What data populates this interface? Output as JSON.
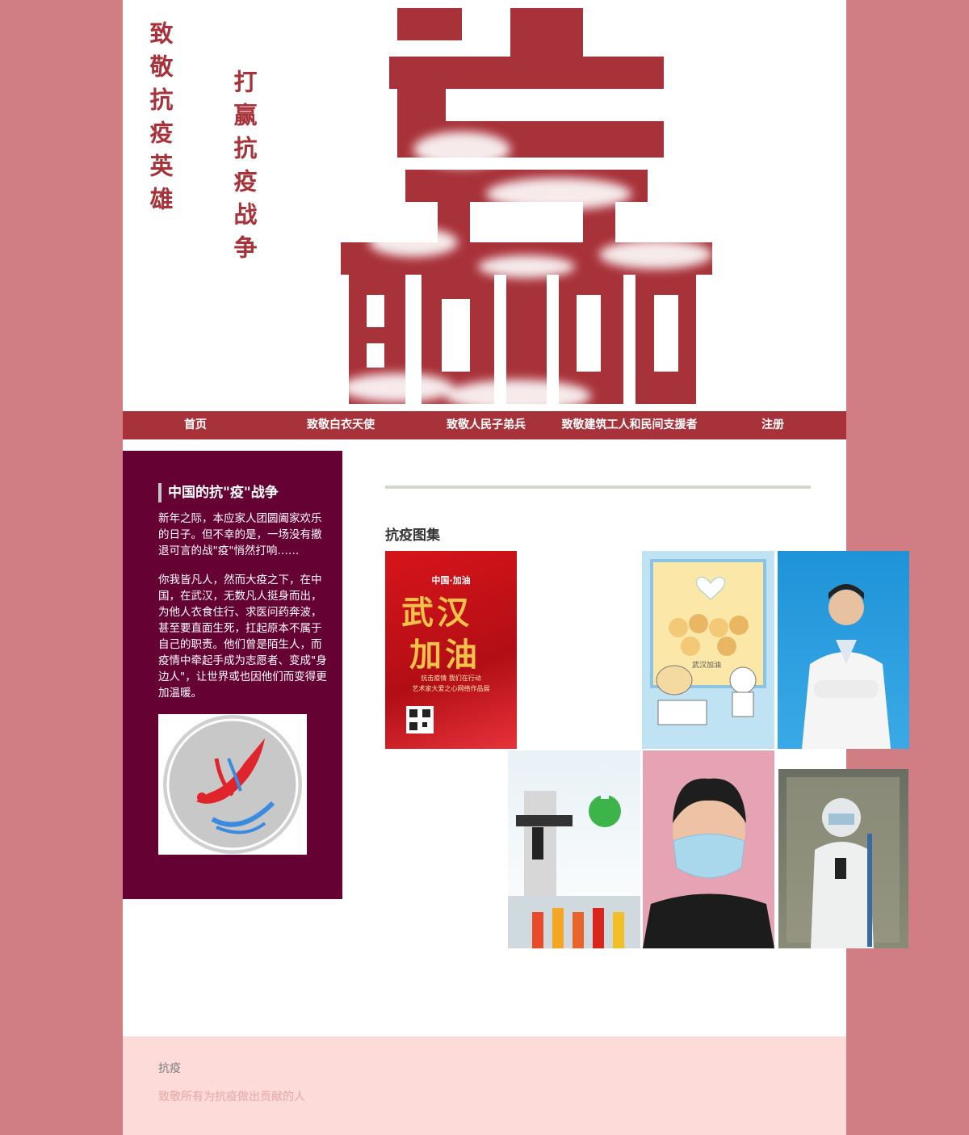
{
  "banner": {
    "poem_left": "致敬抗疫英雄",
    "poem_right": "打赢抗疫战争",
    "big_char": "赢",
    "theme_color": "#a8323a"
  },
  "nav": {
    "items": [
      {
        "label": "首页"
      },
      {
        "label": "致敬白衣天使"
      },
      {
        "label": "致敬人民子弟兵"
      },
      {
        "label": "致敬建筑工人和民间支援者"
      },
      {
        "label": "注册"
      }
    ]
  },
  "sidebar": {
    "title": "中国的抗\"疫\"战争",
    "para1": "新年之际，本应家人团圆阖家欢乐的日子。但不幸的是，一场没有撤退可言的战\"疫\"悄然打响……",
    "para2": "你我皆凡人，然而大疫之下，在中国，在武汉，无数凡人挺身而出，为他人衣食住行、求医问药奔波，甚至要直面生死，扛起原本不属于自己的职责。他们曾是陌生人，而疫情中牵起手成为志愿者、变成\"身边人\"，让世界或也因他们而变得更加温暖。",
    "logo_icon": "dove-logo-icon"
  },
  "gallery": {
    "title": "抗疫图集",
    "poster1": {
      "top": "中国·加油",
      "main1": "武汉",
      "main2": "加油",
      "line1": "抗击疫情  我们在行动",
      "line2": "艺术家大爱之心网络作品展"
    },
    "poster2": {
      "banner": "武汉加油"
    }
  },
  "footer": {
    "title": "抗疫",
    "subtitle": "致敬所有为抗疫做出贡献的人"
  }
}
